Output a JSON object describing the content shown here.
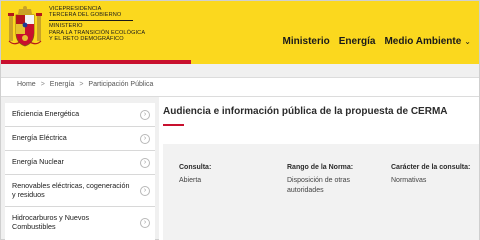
{
  "header": {
    "gov_line1": "Vicepresidencia",
    "gov_line2": "Tercera del Gobierno",
    "gov_line3": "Ministerio",
    "gov_line4": "para la Transición Ecológica",
    "gov_line5": "y el Reto Demográfico",
    "nav": [
      "Ministerio",
      "Energía",
      "Medio Ambiente"
    ],
    "colors": {
      "brand_yellow": "#fbd81e",
      "accent_red": "#c8102e"
    },
    "icons": {
      "logo": "spain-coat-of-arms",
      "dropdown": "chevron-down-icon"
    }
  },
  "breadcrumb": {
    "items": [
      "Home",
      "Energía",
      "Participación Pública"
    ],
    "separator": ">"
  },
  "sidebar": {
    "items": [
      {
        "label": "Eficiencia Energética"
      },
      {
        "label": "Energía Eléctrica"
      },
      {
        "label": "Energía Nuclear"
      },
      {
        "label": "Renovables eléctricas, cogeneración y residuos"
      },
      {
        "label": "Hidrocarburos y Nuevos Combustibles"
      }
    ],
    "expand_icon": "chevron-circle-icon"
  },
  "main": {
    "title": "Audiencia e información pública de la propuesta de CERMA",
    "info": {
      "consulta_label": "Consulta:",
      "consulta_value": "Abierta",
      "rango_label": "Rango de la Norma:",
      "rango_value": "Disposición de otras autoridades",
      "caracter_label": "Carácter de la consulta:",
      "caracter_value": "Normativas"
    }
  }
}
